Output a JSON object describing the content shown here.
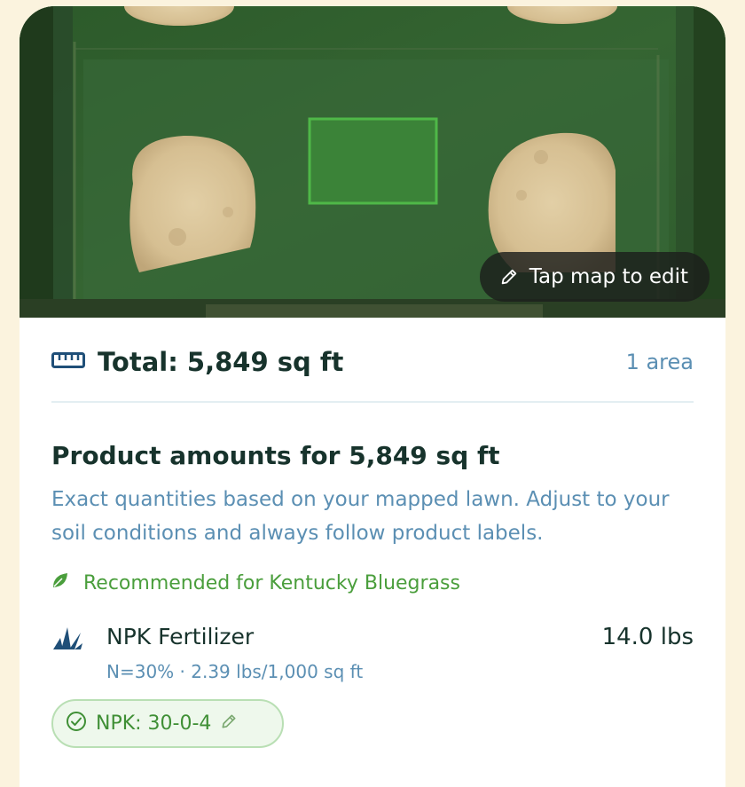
{
  "map": {
    "edit_label": "Tap map to edit",
    "selection_color": "#4fb848"
  },
  "summary": {
    "total_label": "Total: 5,849 sq ft",
    "area_count": "1 area"
  },
  "amounts": {
    "heading": "Product amounts for 5,849 sq ft",
    "description": "Exact quantities based on your mapped lawn. Adjust to your soil conditions and always follow product labels.",
    "recommendation": "Recommended for Kentucky Bluegrass"
  },
  "product": {
    "name": "NPK Fertilizer",
    "detail": "N=30% · 2.39 lbs/1,000 sq ft",
    "amount": "14.0 lbs",
    "npk_chip": "NPK: 30-0-4"
  },
  "colors": {
    "page_background": "#fbf3de",
    "primary_text": "#17332c",
    "secondary_text": "#5b8fb3",
    "accent_green": "#4a9e3c"
  },
  "icons": {
    "edit": "pencil-icon",
    "ruler": "ruler-icon",
    "leaf": "leaf-icon",
    "grass": "grass-icon",
    "check": "check-circle-icon",
    "chip_edit": "pencil-icon"
  }
}
